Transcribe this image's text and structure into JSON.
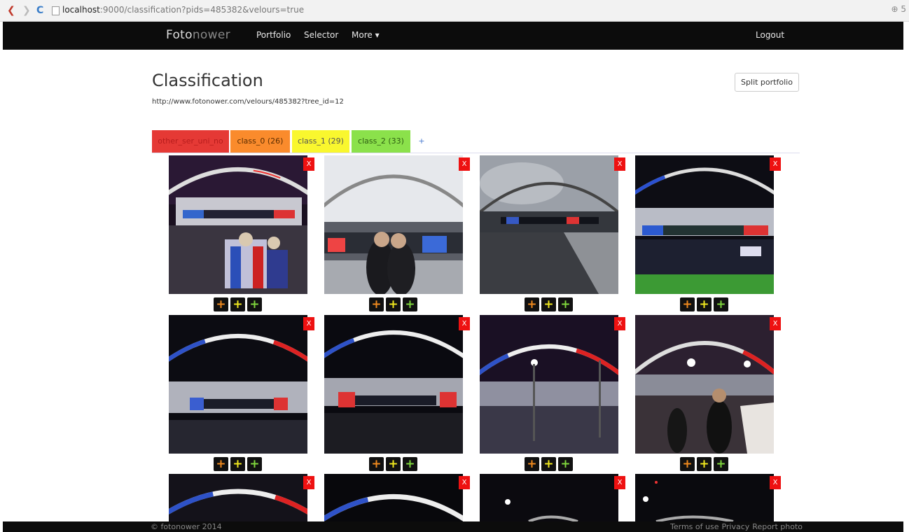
{
  "browser": {
    "url_host": "localhost",
    "url_rest": ":9000/classification?pids=485382&velours=true",
    "zoom_glyph": "⊕ 5"
  },
  "navbar": {
    "brand_a": "Foto",
    "brand_b": "nower",
    "portfolio": "Portfolio",
    "selector": "Selector",
    "more": "More ▾",
    "logout": "Logout"
  },
  "page": {
    "title": "Classification",
    "url": "http://www.fotonower.com/velours/485382?tree_id=12",
    "split_button": "Split portfolio"
  },
  "tabs": {
    "other": "other_ser_uni_no",
    "class0": "class_0 (26)",
    "class1": "class_1 (29)",
    "class2": "class_2 (33)",
    "add": "+"
  },
  "photo_controls": {
    "delete": "X",
    "add": "+"
  },
  "footer": {
    "copyright": "© fotonower 2014",
    "terms": "Terms of use",
    "privacy": "Privacy",
    "report": "Report photo"
  },
  "colors": {
    "class_other": "#e53935",
    "class_0": "#fa8b2c",
    "class_1": "#f9f72e",
    "class_2": "#8be14b",
    "navbar": "#0c0c0c",
    "delete": "#ee1111"
  }
}
